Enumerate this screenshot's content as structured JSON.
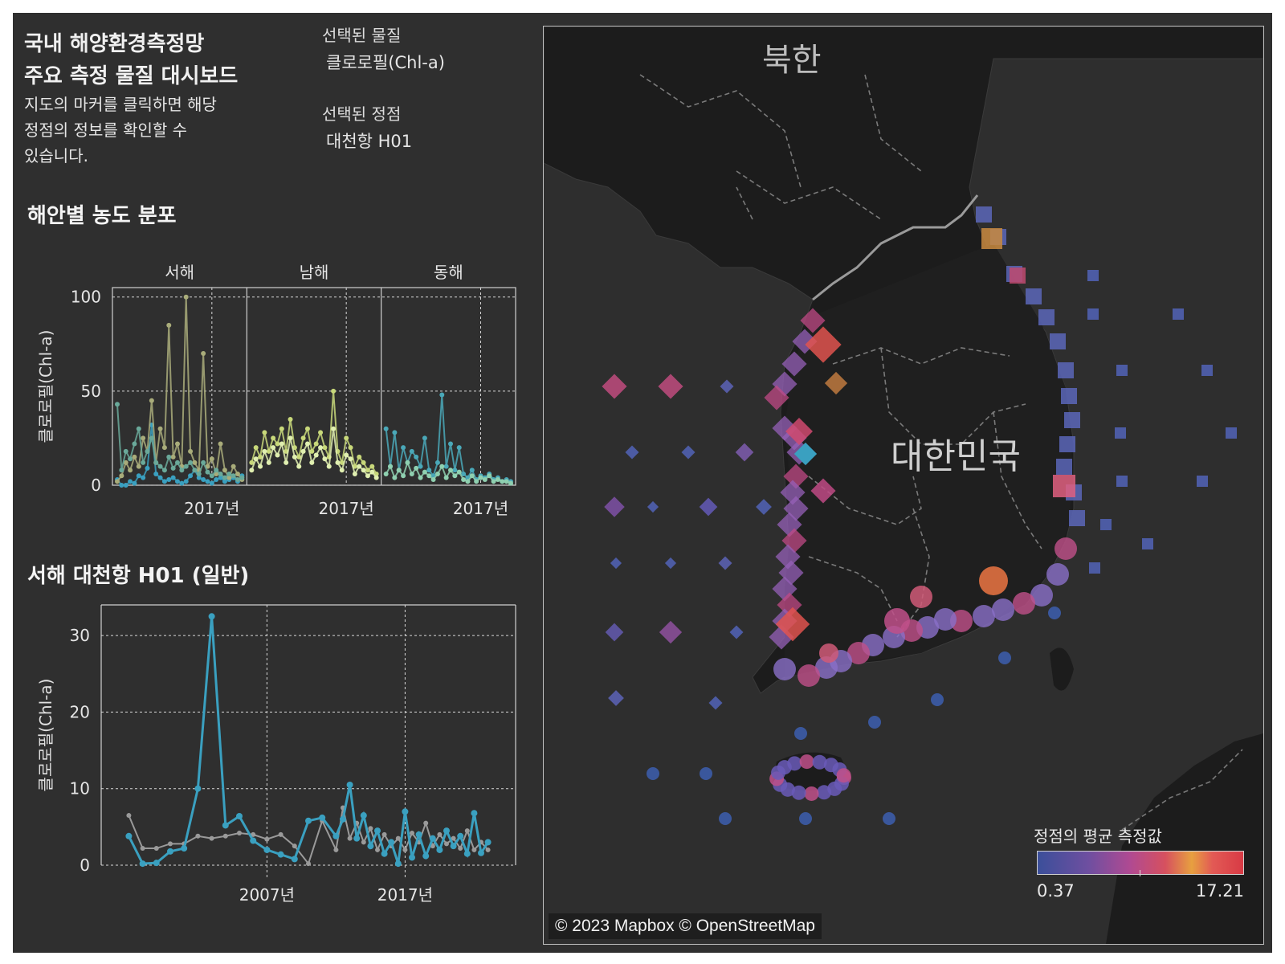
{
  "header": {
    "title_line1": "국내 해양환경측정망",
    "title_line2": "주요 측정 물질 대시보드",
    "desc_line1": "지도의 마커를 클릭하면 해당",
    "desc_line2": "정점의 정보를 확인할 수",
    "desc_line3": "있습니다."
  },
  "selection": {
    "substance_label": "선택된 물질",
    "substance_value": "클로로필(Chl-a)",
    "station_label": "선택된 정점",
    "station_value": "대천항 H01"
  },
  "map": {
    "label_north": "북한",
    "label_south": "대한민국",
    "attribution": "© 2023 Mapbox © OpenStreetMap",
    "legend": {
      "title": "정점의 평균 측정값",
      "min": "0.37",
      "max": "17.21",
      "colors": [
        "#3b4f9a",
        "#b04a92",
        "#e7a040",
        "#d83a45"
      ]
    },
    "colors": {
      "west_marker": "#9b5fb0",
      "south_marker": "#8a6fc8",
      "east_marker": "#4f63b0",
      "selected": "#3aa0c0",
      "high": "#e0534f"
    }
  },
  "chart_data": [
    {
      "type": "line",
      "title": "해안별 농도 분포",
      "ylabel": "클로로필(Chl-a)",
      "ylim": [
        0,
        105
      ],
      "yticks": [
        0,
        50,
        100
      ],
      "facets": [
        "서해",
        "남해",
        "동해"
      ],
      "xtick_label": "2017년",
      "series": [
        {
          "facet": "서해",
          "color": "#3aa0c0",
          "values": [
            3,
            0,
            0,
            2,
            1,
            5,
            4,
            9,
            32,
            6,
            4,
            2,
            3,
            4,
            2,
            1,
            2,
            5,
            8,
            4,
            3,
            2,
            1,
            3,
            4,
            2,
            3,
            4,
            2,
            5
          ]
        },
        {
          "facet": "서해",
          "color": "#a9ac7a",
          "values": [
            2,
            5,
            12,
            8,
            15,
            10,
            25,
            18,
            45,
            12,
            30,
            20,
            85,
            15,
            22,
            10,
            100,
            18,
            12,
            8,
            70,
            10,
            14,
            6,
            22,
            8,
            4,
            10,
            6,
            3
          ]
        },
        {
          "facet": "서해",
          "color": "#6aa99a",
          "values": [
            43,
            8,
            18,
            14,
            22,
            30,
            12,
            18,
            25,
            12,
            10,
            8,
            15,
            9,
            12,
            8,
            10,
            12,
            8,
            6,
            12,
            7,
            5,
            8,
            6,
            4,
            6,
            5,
            3,
            4
          ]
        },
        {
          "facet": "남해",
          "color": "#c8d87a",
          "values": [
            12,
            20,
            15,
            28,
            18,
            25,
            22,
            30,
            18,
            35,
            20,
            15,
            25,
            30,
            18,
            22,
            28,
            20,
            15,
            50,
            18,
            12,
            25,
            20,
            10,
            15,
            12,
            8,
            10,
            6
          ]
        },
        {
          "facet": "남해",
          "color": "#e0efb0",
          "values": [
            8,
            14,
            10,
            18,
            12,
            20,
            16,
            22,
            12,
            25,
            15,
            10,
            18,
            22,
            12,
            16,
            20,
            14,
            10,
            30,
            12,
            8,
            16,
            14,
            6,
            10,
            8,
            5,
            7,
            4
          ]
        },
        {
          "facet": "동해",
          "color": "#4aa8b8",
          "values": [
            30,
            10,
            28,
            8,
            20,
            12,
            18,
            15,
            10,
            25,
            8,
            5,
            12,
            48,
            10,
            22,
            8,
            20,
            6,
            4,
            8,
            3,
            5,
            4,
            6,
            3,
            4,
            2,
            3,
            2
          ]
        },
        {
          "facet": "동해",
          "color": "#8fd0b0",
          "values": [
            6,
            10,
            4,
            8,
            5,
            12,
            6,
            9,
            4,
            7,
            5,
            3,
            6,
            10,
            4,
            8,
            5,
            7,
            3,
            2,
            5,
            2,
            4,
            3,
            5,
            2,
            3,
            2,
            2,
            1
          ]
        }
      ]
    },
    {
      "type": "line",
      "title": "서해 대천항 H01 (일반)",
      "ylabel": "클로로필(Chl-a)",
      "ylim": [
        0,
        34
      ],
      "yticks": [
        0,
        10,
        20,
        30
      ],
      "xticks": [
        "2007년",
        "2017년"
      ],
      "x": [
        1997,
        1998,
        1999,
        2000,
        2001,
        2002,
        2003,
        2004,
        2005,
        2006,
        2007,
        2008,
        2009,
        2010,
        2011,
        2012,
        2012.5,
        2013,
        2013.5,
        2014,
        2014.5,
        2015,
        2015.5,
        2016,
        2016.5,
        2017,
        2017.5,
        2018,
        2018.5,
        2019,
        2019.5,
        2020,
        2020.5,
        2021,
        2021.5,
        2022,
        2022.5,
        2023
      ],
      "series": [
        {
          "name": "대천항 H01",
          "color": "#3aa0c0",
          "values": [
            3.8,
            0.2,
            0.3,
            1.8,
            2.2,
            10.0,
            32.5,
            5.2,
            6.4,
            3.2,
            2.0,
            1.4,
            0.8,
            5.8,
            6.2,
            3.8,
            6.0,
            10.5,
            3.5,
            6.5,
            2.5,
            4.5,
            1.5,
            3.0,
            0.2,
            7.0,
            1.0,
            4.0,
            1.2,
            3.5,
            2.0,
            4.5,
            2.5,
            3.8,
            1.5,
            6.8,
            1.6,
            3.0
          ]
        },
        {
          "name": "",
          "color": "#9a9a9a",
          "values": [
            6.5,
            2.2,
            2.2,
            2.8,
            2.8,
            3.8,
            3.5,
            3.8,
            4.2,
            4.0,
            3.4,
            4.0,
            2.5,
            0.2,
            5.8,
            2.0,
            7.5,
            3.5,
            5.5,
            3.0,
            4.8,
            2.0,
            4.0,
            2.5,
            3.5,
            2.0,
            4.2,
            3.0,
            5.5,
            2.5,
            4.0,
            2.8,
            3.5,
            2.2,
            4.5,
            2.0,
            3.0,
            2.0
          ]
        }
      ]
    }
  ]
}
